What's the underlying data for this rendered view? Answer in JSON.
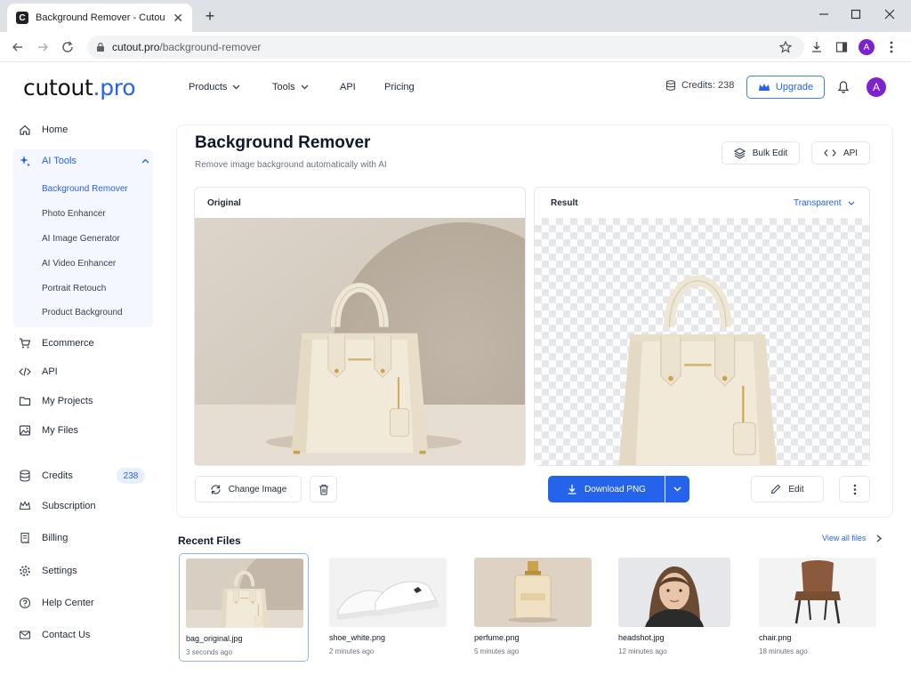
{
  "browser": {
    "tab_title": "Background Remover - Cutout.Pro",
    "favicon_letter": "C",
    "url_host": "cutout.pro",
    "url_path": "/background-remover",
    "profile_initial": "A"
  },
  "header": {
    "logo_text": "cutout",
    "logo_suffix": ".pro",
    "nav": [
      {
        "label": "Products",
        "has_dropdown": true
      },
      {
        "label": "Tools",
        "has_dropdown": true
      },
      {
        "label": "API",
        "has_dropdown": false
      },
      {
        "label": "Pricing",
        "has_dropdown": false
      }
    ],
    "credits_label": "Credits: 238",
    "upgrade_label": "Upgrade",
    "avatar_initial": "A"
  },
  "sidebar": {
    "items_top": [
      {
        "label": "Home",
        "icon": "home-icon"
      },
      {
        "label": "AI Tools",
        "icon": "sparkle-icon",
        "active": true
      }
    ],
    "sub_items": [
      {
        "label": "Background Remover",
        "active": true
      },
      {
        "label": "Photo Enhancer"
      },
      {
        "label": "AI Image Generator"
      },
      {
        "label": "AI Video Enhancer"
      },
      {
        "label": "Portrait Retouch"
      },
      {
        "label": "Product Background"
      }
    ],
    "items_mid": [
      {
        "label": "Ecommerce",
        "icon": "cart-icon"
      },
      {
        "label": "API",
        "icon": "code-icon"
      },
      {
        "label": "My Projects",
        "icon": "folder-icon"
      },
      {
        "label": "My Files",
        "icon": "image-icon"
      }
    ],
    "items_bottom": [
      {
        "label": "Credits",
        "icon": "database-icon",
        "badge": "238"
      },
      {
        "label": "Subscription",
        "icon": "crown-icon"
      },
      {
        "label": "Billing",
        "icon": "receipt-icon"
      },
      {
        "label": "Settings",
        "icon": "gear-icon"
      },
      {
        "label": "Help Center",
        "icon": "help-icon"
      },
      {
        "label": "Contact Us",
        "icon": "mail-icon"
      }
    ]
  },
  "main": {
    "title": "Background Remover",
    "subtitle": "Remove image background automatically with AI",
    "bulk_edit_label": "Bulk Edit",
    "api_label": "API",
    "original_label": "Original",
    "result_label": "Result",
    "background_select": "Transparent",
    "change_image_label": "Change Image",
    "download_label": "Download PNG",
    "edit_label": "Edit"
  },
  "recent": {
    "title": "Recent Files",
    "view_all": "View all files",
    "files": [
      {
        "name": "bag_original.jpg",
        "time": "3 seconds ago",
        "selected": true
      },
      {
        "name": "shoe_white.png",
        "time": "2 minutes ago"
      },
      {
        "name": "perfume.png",
        "time": "5 minutes ago"
      },
      {
        "name": "headshot.jpg",
        "time": "12 minutes ago"
      },
      {
        "name": "chair.png",
        "time": "18 minutes ago"
      }
    ]
  },
  "colors": {
    "accent": "#2563eb",
    "avatar": "#7e22ce",
    "sidebar_active_bg": "#f4f7fd"
  }
}
